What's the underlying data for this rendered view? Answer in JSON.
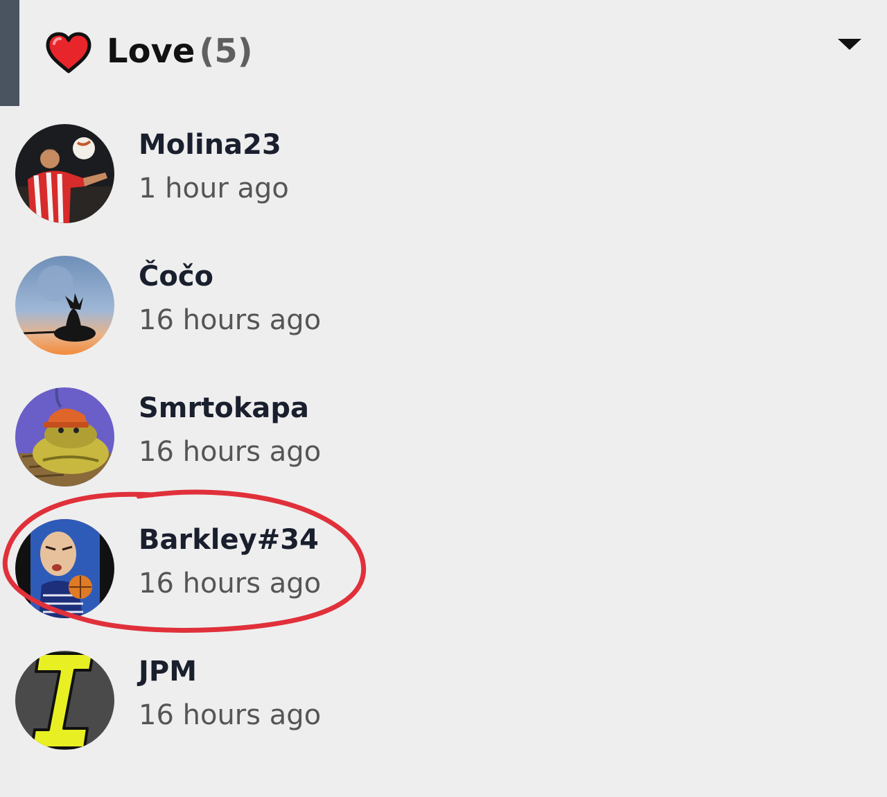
{
  "header": {
    "icon": "heart-icon",
    "title": "Love",
    "count": "(5)",
    "toggle_icon": "caret-down-icon"
  },
  "users": [
    {
      "name": "Molina23",
      "time": "1 hour ago",
      "avatar": "soccer-player-avatar"
    },
    {
      "name": "Čočo",
      "time": "16 hours ago",
      "avatar": "moon-silhouette-avatar"
    },
    {
      "name": "Smrtokapa",
      "time": "16 hours ago",
      "avatar": "cartoon-crocodile-avatar"
    },
    {
      "name": "Barkley#34",
      "time": "16 hours ago",
      "avatar": "basketball-cartoon-avatar"
    },
    {
      "name": "JPM",
      "time": "16 hours ago",
      "avatar": "yellow-logo-avatar"
    }
  ],
  "colors": {
    "background": "#eeeeee",
    "side_bar": "#4a5360",
    "heart": "#e8252b",
    "highlight_circle": "#e0303a",
    "username": "#1a1f2e",
    "timestamp": "#555555"
  }
}
